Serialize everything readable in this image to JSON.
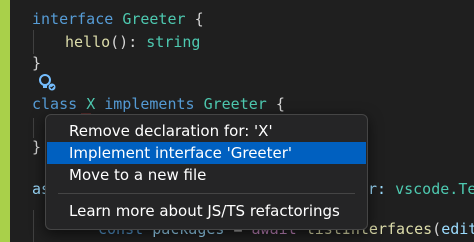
{
  "code": {
    "line1": {
      "k": "interface",
      "name": "Greeter",
      "brace": "{"
    },
    "line2": {
      "method": "hello",
      "sig": "():",
      "type": "string"
    },
    "line3": {
      "brace": "}"
    },
    "line5": {
      "k": "class",
      "name": "X",
      "k2": "implements",
      "iface": "Greeter",
      "brace": "{"
    },
    "line7": {
      "brace": "}"
    },
    "line9": {
      "prefix": "as",
      "after": "r: ",
      "ns": "vscode.",
      "tail": "Tex"
    },
    "line10": {
      "k": "const",
      "var": "packages",
      "eq": "=",
      "await": "await",
      "call": "listInterfaces",
      "arg": "editor",
      "close": ")"
    }
  },
  "context_menu": {
    "items": [
      {
        "label": "Remove declaration for: 'X'"
      },
      {
        "label": "Implement interface 'Greeter'"
      },
      {
        "label": "Move to a new file"
      },
      {
        "label": "Learn more about JS/TS refactorings"
      }
    ],
    "selected_index": 1
  },
  "colors": {
    "selection": "#0060c0",
    "background": "#1f1f1f",
    "menu_background": "#252526",
    "git_gutter": "#a9d04a"
  },
  "icons": {
    "lightbulb": "lightbulb-autofix-icon"
  }
}
